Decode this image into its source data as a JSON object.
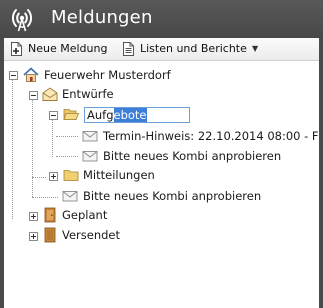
{
  "header": {
    "title": "Meldungen",
    "icon": "broadcast-icon"
  },
  "toolbar": {
    "new_label": "Neue Meldung",
    "lists_label": "Listen und Berichte"
  },
  "tree": {
    "root": "Feuerwehr Musterdorf",
    "drafts": "Entwürfe",
    "edit_text_plain": "Aufg",
    "edit_text_selected": "ebote",
    "msg_termin": "Termin-Hinweis: 22.10.2014 08:00 - F",
    "msg_kombi_1": "Bitte neues Kombi anprobieren",
    "mitteilungen": "Mitteilungen",
    "msg_kombi_2": "Bitte neues Kombi anprobieren",
    "geplant": "Geplant",
    "versendet": "Versendet"
  },
  "colors": {
    "header_bg": "#4a4a4a",
    "selection": "#3c7fd8",
    "edit_border": "#6a9fd8"
  }
}
